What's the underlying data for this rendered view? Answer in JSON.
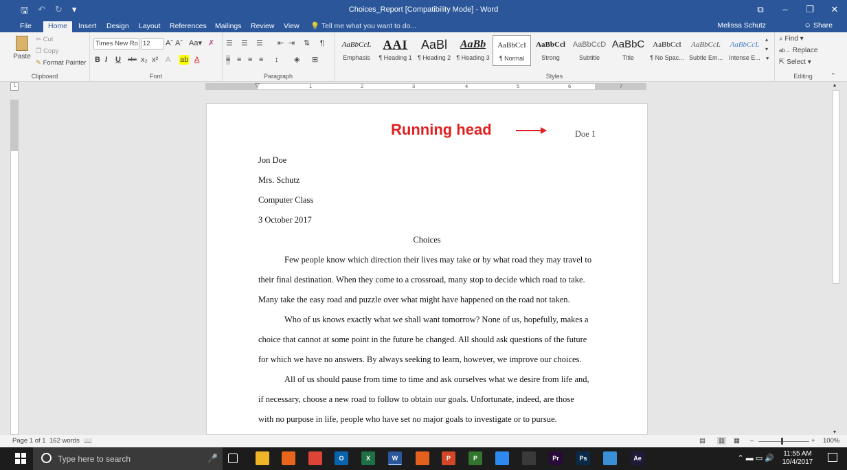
{
  "titlebar": {
    "title": "Choices_Report [Compatibility Mode] - Word",
    "save_icon": "save-icon",
    "undo_icon": "undo-icon",
    "redo_icon": "redo-icon",
    "ribbon_display_icon": "ribbon-display-options-icon",
    "minimize_icon": "minimize-icon",
    "restore_icon": "restore-icon",
    "close_icon": "close-icon"
  },
  "tabs": [
    "File",
    "Home",
    "Insert",
    "Design",
    "Layout",
    "References",
    "Mailings",
    "Review",
    "View"
  ],
  "active_tab": "Home",
  "tell_me": "Tell me what you want to do...",
  "user": "Melissa Schutz",
  "share": "Share",
  "clipboard": {
    "paste": "Paste",
    "cut": "Cut",
    "copy": "Copy",
    "format_painter": "Format Painter",
    "label": "Clipboard"
  },
  "font": {
    "family": "Times New Ro",
    "size": "12",
    "label": "Font"
  },
  "paragraph": {
    "label": "Paragraph"
  },
  "styles": {
    "label": "Styles",
    "items": [
      {
        "sample": "AaBbCcL",
        "name": "Emphasis"
      },
      {
        "sample": "AAI",
        "name": "¶ Heading 1"
      },
      {
        "sample": "AaBl",
        "name": "¶ Heading 2"
      },
      {
        "sample": "AaBb",
        "name": "¶ Heading 3"
      },
      {
        "sample": "AaBbCcI",
        "name": "¶ Normal"
      },
      {
        "sample": "AaBbCcl",
        "name": "Strong"
      },
      {
        "sample": "AaBbCcD",
        "name": "Subtitle"
      },
      {
        "sample": "AaBbC",
        "name": "Title"
      },
      {
        "sample": "AaBbCcI",
        "name": "¶ No Spac..."
      },
      {
        "sample": "AaBbCcL",
        "name": "Subtle Em..."
      },
      {
        "sample": "AaBbCcL",
        "name": "Intense E..."
      }
    ],
    "selected_index": 4
  },
  "editing": {
    "find": "Find",
    "replace": "Replace",
    "select": "Select",
    "label": "Editing"
  },
  "ruler_numbers": [
    "1",
    "2",
    "3",
    "4",
    "5",
    "6",
    "7"
  ],
  "document": {
    "annotation": "Running head",
    "page_number": "Doe 1",
    "lines": [
      "Jon Doe",
      "Mrs. Schutz",
      "Computer Class",
      "3 October 2017",
      "Choices",
      "Few people know which direction their lives may take or by what road they may travel to",
      "their final destination.  When they come to a crossroad, many stop to decide which road to take.",
      "Many take the easy road and puzzle over what might have happened on the road not taken.",
      "Who of us knows exactly what we shall want tomorrow?  None of us, hopefully, makes a",
      "choice that cannot at some point in the future be changed.  All should ask questions of the future",
      "for which we have no answers.  By always seeking to learn, however, we improve our choices.",
      "All of us should pause from time to time and ask ourselves what we desire from life and,",
      "if necessary, choose a new road to follow to obtain our goals.  Unfortunate, indeed, are those",
      "with no purpose in life, people who have set no major goals to investigate or to pursue."
    ]
  },
  "status": {
    "page": "Page 1 of 1",
    "words": "162 words",
    "zoom": "100%"
  },
  "taskbar": {
    "search_placeholder": "Type here to search",
    "time": "11:55 AM",
    "date": "10/4/2017",
    "apps": [
      {
        "name": "task-view-icon",
        "label": "",
        "color": "#1c1c1c"
      },
      {
        "name": "file-explorer-icon",
        "label": "",
        "color": "#f0b429"
      },
      {
        "name": "firefox-icon",
        "label": "",
        "color": "#e8661c"
      },
      {
        "name": "chrome-icon",
        "label": "",
        "color": "#db4437"
      },
      {
        "name": "outlook-icon",
        "label": "O",
        "color": "#0a64ad"
      },
      {
        "name": "excel-icon",
        "label": "X",
        "color": "#1e7145"
      },
      {
        "name": "word-icon",
        "label": "W",
        "color": "#2b579a"
      },
      {
        "name": "app-orange-icon",
        "label": "",
        "color": "#e3601f"
      },
      {
        "name": "powerpoint-icon",
        "label": "P",
        "color": "#d24726"
      },
      {
        "name": "project-icon",
        "label": "P",
        "color": "#31752f"
      },
      {
        "name": "notes-icon",
        "label": "",
        "color": "#2d89ef"
      },
      {
        "name": "calculator-icon",
        "label": "",
        "color": "#3a3a3a"
      },
      {
        "name": "premiere-icon",
        "label": "Pr",
        "color": "#2a0a3a"
      },
      {
        "name": "photoshop-icon",
        "label": "Ps",
        "color": "#0a2a4a"
      },
      {
        "name": "app-globe-icon",
        "label": "",
        "color": "#3a8fd6"
      },
      {
        "name": "after-effects-icon",
        "label": "Ae",
        "color": "#1e1a3a"
      }
    ]
  },
  "colors": {
    "word_blue": "#2b579a",
    "annotation_red": "#e02020"
  }
}
